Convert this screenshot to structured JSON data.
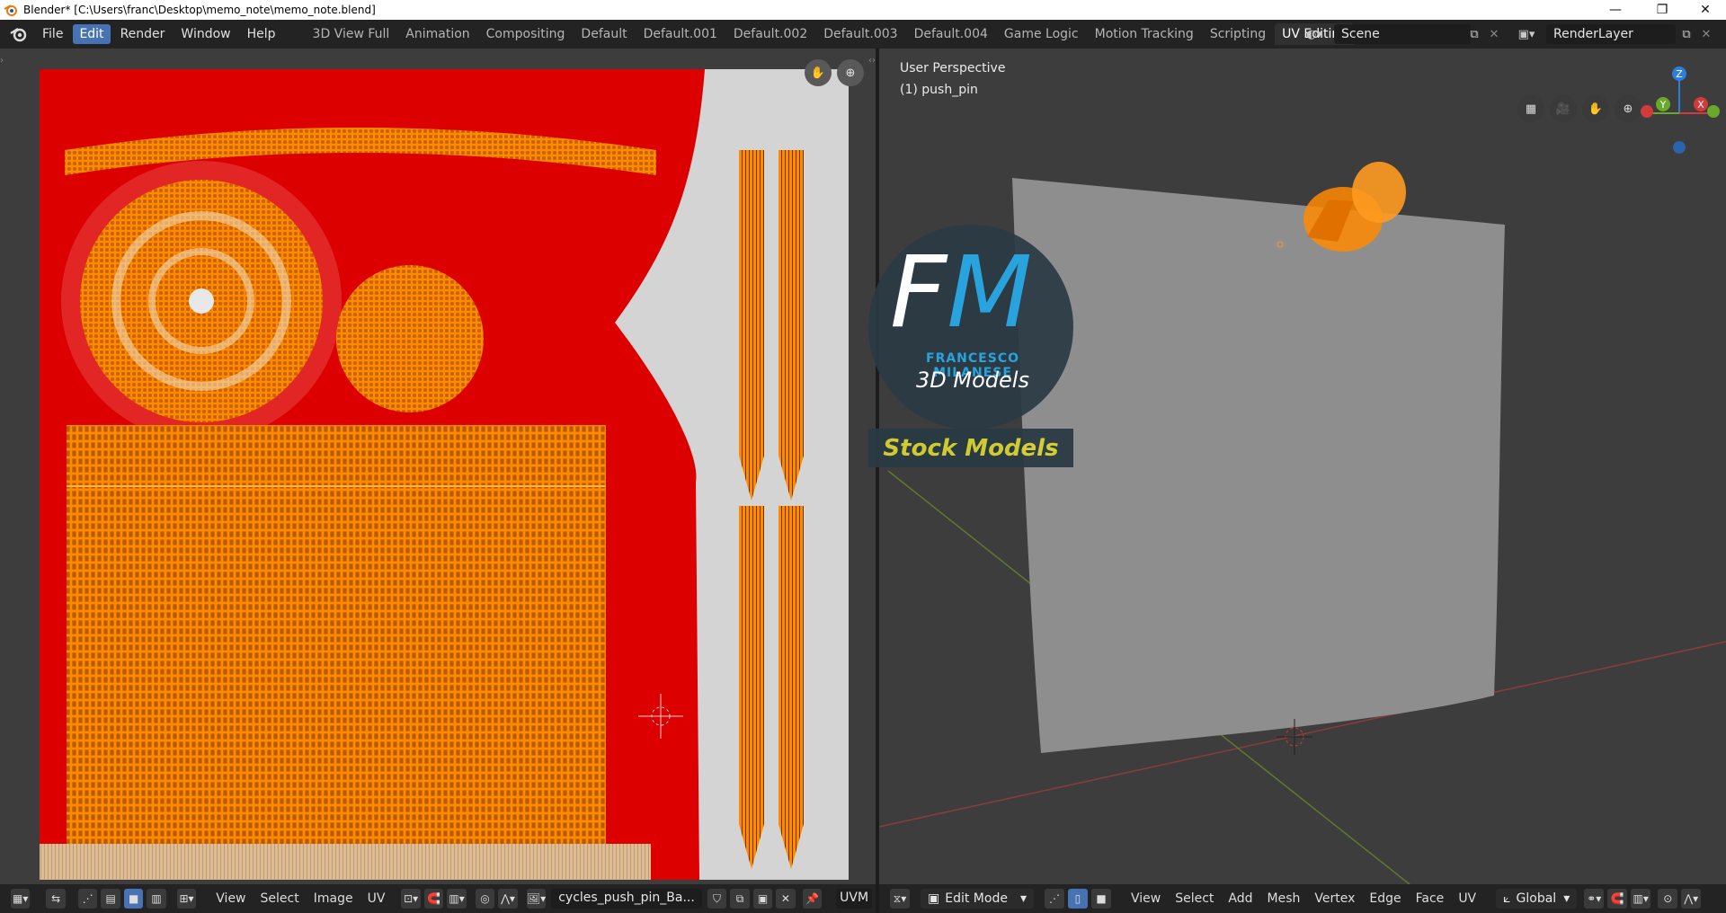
{
  "window": {
    "title": "Blender* [C:\\Users\\franc\\Desktop\\memo_note\\memo_note.blend]",
    "minimize": "—",
    "restore": "❐",
    "close": "✕"
  },
  "menu": [
    "File",
    "Edit",
    "Render",
    "Window",
    "Help"
  ],
  "menu_active_index": 1,
  "workspaces": [
    "3D View Full",
    "Animation",
    "Compositing",
    "Default",
    "Default.001",
    "Default.002",
    "Default.003",
    "Default.004",
    "Game Logic",
    "Motion Tracking",
    "Scripting",
    "UV Editing"
  ],
  "workspace_active_index": 11,
  "scene": {
    "name": "Scene",
    "render_layer": "RenderLayer"
  },
  "uv_editor": {
    "header_menus": [
      "View",
      "Select",
      "Image",
      "UV"
    ],
    "image_name": "cycles_push_pin_Ba...",
    "uvmap_label": "UVM"
  },
  "viewport": {
    "perspective_label": "User Perspective",
    "object_label": "(1) push_pin",
    "gizmo_axes": {
      "z": "Z",
      "y": "Y",
      "x": "X"
    },
    "mode": "Edit Mode",
    "header_menus": [
      "View",
      "Select",
      "Add",
      "Mesh",
      "Vertex",
      "Edge",
      "Face",
      "UV"
    ],
    "orientation": "Global"
  },
  "watermark": {
    "letter_f": "F",
    "letter_m": "M",
    "name": "FRANCESCO MILANESE",
    "subtitle": "3D Models",
    "banner": "Stock Models"
  },
  "colors": {
    "accent": "#4772b3",
    "uv_red": "#dd0000",
    "uv_orange": "#ff8a00",
    "fm_blue": "#29a3dd",
    "fm_yellow": "#d7d232"
  }
}
